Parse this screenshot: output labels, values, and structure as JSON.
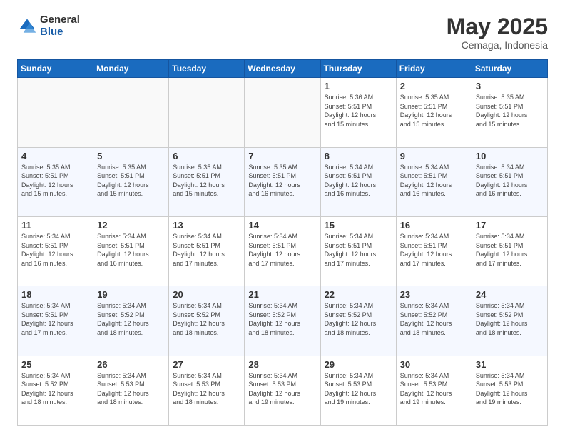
{
  "header": {
    "logo_general": "General",
    "logo_blue": "Blue",
    "month_title": "May 2025",
    "location": "Cemaga, Indonesia"
  },
  "days_of_week": [
    "Sunday",
    "Monday",
    "Tuesday",
    "Wednesday",
    "Thursday",
    "Friday",
    "Saturday"
  ],
  "weeks": [
    [
      {
        "day": "",
        "info": ""
      },
      {
        "day": "",
        "info": ""
      },
      {
        "day": "",
        "info": ""
      },
      {
        "day": "",
        "info": ""
      },
      {
        "day": "1",
        "info": "Sunrise: 5:36 AM\nSunset: 5:51 PM\nDaylight: 12 hours\nand 15 minutes."
      },
      {
        "day": "2",
        "info": "Sunrise: 5:35 AM\nSunset: 5:51 PM\nDaylight: 12 hours\nand 15 minutes."
      },
      {
        "day": "3",
        "info": "Sunrise: 5:35 AM\nSunset: 5:51 PM\nDaylight: 12 hours\nand 15 minutes."
      }
    ],
    [
      {
        "day": "4",
        "info": "Sunrise: 5:35 AM\nSunset: 5:51 PM\nDaylight: 12 hours\nand 15 minutes."
      },
      {
        "day": "5",
        "info": "Sunrise: 5:35 AM\nSunset: 5:51 PM\nDaylight: 12 hours\nand 15 minutes."
      },
      {
        "day": "6",
        "info": "Sunrise: 5:35 AM\nSunset: 5:51 PM\nDaylight: 12 hours\nand 15 minutes."
      },
      {
        "day": "7",
        "info": "Sunrise: 5:35 AM\nSunset: 5:51 PM\nDaylight: 12 hours\nand 16 minutes."
      },
      {
        "day": "8",
        "info": "Sunrise: 5:34 AM\nSunset: 5:51 PM\nDaylight: 12 hours\nand 16 minutes."
      },
      {
        "day": "9",
        "info": "Sunrise: 5:34 AM\nSunset: 5:51 PM\nDaylight: 12 hours\nand 16 minutes."
      },
      {
        "day": "10",
        "info": "Sunrise: 5:34 AM\nSunset: 5:51 PM\nDaylight: 12 hours\nand 16 minutes."
      }
    ],
    [
      {
        "day": "11",
        "info": "Sunrise: 5:34 AM\nSunset: 5:51 PM\nDaylight: 12 hours\nand 16 minutes."
      },
      {
        "day": "12",
        "info": "Sunrise: 5:34 AM\nSunset: 5:51 PM\nDaylight: 12 hours\nand 16 minutes."
      },
      {
        "day": "13",
        "info": "Sunrise: 5:34 AM\nSunset: 5:51 PM\nDaylight: 12 hours\nand 17 minutes."
      },
      {
        "day": "14",
        "info": "Sunrise: 5:34 AM\nSunset: 5:51 PM\nDaylight: 12 hours\nand 17 minutes."
      },
      {
        "day": "15",
        "info": "Sunrise: 5:34 AM\nSunset: 5:51 PM\nDaylight: 12 hours\nand 17 minutes."
      },
      {
        "day": "16",
        "info": "Sunrise: 5:34 AM\nSunset: 5:51 PM\nDaylight: 12 hours\nand 17 minutes."
      },
      {
        "day": "17",
        "info": "Sunrise: 5:34 AM\nSunset: 5:51 PM\nDaylight: 12 hours\nand 17 minutes."
      }
    ],
    [
      {
        "day": "18",
        "info": "Sunrise: 5:34 AM\nSunset: 5:51 PM\nDaylight: 12 hours\nand 17 minutes."
      },
      {
        "day": "19",
        "info": "Sunrise: 5:34 AM\nSunset: 5:52 PM\nDaylight: 12 hours\nand 18 minutes."
      },
      {
        "day": "20",
        "info": "Sunrise: 5:34 AM\nSunset: 5:52 PM\nDaylight: 12 hours\nand 18 minutes."
      },
      {
        "day": "21",
        "info": "Sunrise: 5:34 AM\nSunset: 5:52 PM\nDaylight: 12 hours\nand 18 minutes."
      },
      {
        "day": "22",
        "info": "Sunrise: 5:34 AM\nSunset: 5:52 PM\nDaylight: 12 hours\nand 18 minutes."
      },
      {
        "day": "23",
        "info": "Sunrise: 5:34 AM\nSunset: 5:52 PM\nDaylight: 12 hours\nand 18 minutes."
      },
      {
        "day": "24",
        "info": "Sunrise: 5:34 AM\nSunset: 5:52 PM\nDaylight: 12 hours\nand 18 minutes."
      }
    ],
    [
      {
        "day": "25",
        "info": "Sunrise: 5:34 AM\nSunset: 5:52 PM\nDaylight: 12 hours\nand 18 minutes."
      },
      {
        "day": "26",
        "info": "Sunrise: 5:34 AM\nSunset: 5:53 PM\nDaylight: 12 hours\nand 18 minutes."
      },
      {
        "day": "27",
        "info": "Sunrise: 5:34 AM\nSunset: 5:53 PM\nDaylight: 12 hours\nand 18 minutes."
      },
      {
        "day": "28",
        "info": "Sunrise: 5:34 AM\nSunset: 5:53 PM\nDaylight: 12 hours\nand 19 minutes."
      },
      {
        "day": "29",
        "info": "Sunrise: 5:34 AM\nSunset: 5:53 PM\nDaylight: 12 hours\nand 19 minutes."
      },
      {
        "day": "30",
        "info": "Sunrise: 5:34 AM\nSunset: 5:53 PM\nDaylight: 12 hours\nand 19 minutes."
      },
      {
        "day": "31",
        "info": "Sunrise: 5:34 AM\nSunset: 5:53 PM\nDaylight: 12 hours\nand 19 minutes."
      }
    ]
  ]
}
